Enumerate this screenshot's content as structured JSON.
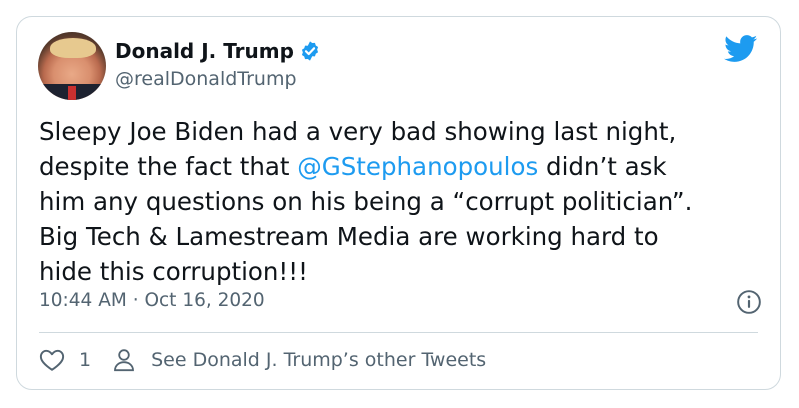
{
  "author": {
    "name": "Donald J. Trump",
    "handle": "@realDonaldTrump",
    "verified": true
  },
  "tweet": {
    "text_before_mention": "Sleepy Joe Biden had a very bad showing last night,\ndespite the fact that ",
    "mention": "@GStephanopoulos",
    "text_after_mention": " didn’t ask\nhim any questions on his being a “corrupt politician”.\nBig Tech & Lamestream Media are working hard to\nhide this corruption!!!",
    "timestamp": "10:44 AM · Oct 16, 2020"
  },
  "actions": {
    "like_count": "1",
    "other_tweets_label": "See Donald J. Trump’s other Tweets"
  },
  "icons": {
    "brand": "twitter-bird-icon",
    "verified": "verified-badge-icon",
    "info": "info-icon",
    "like": "heart-icon",
    "profile": "person-icon"
  },
  "colors": {
    "accent": "#1d9bf0",
    "text_primary": "#0f1419",
    "text_secondary": "#536471",
    "border": "#cfd9de"
  }
}
